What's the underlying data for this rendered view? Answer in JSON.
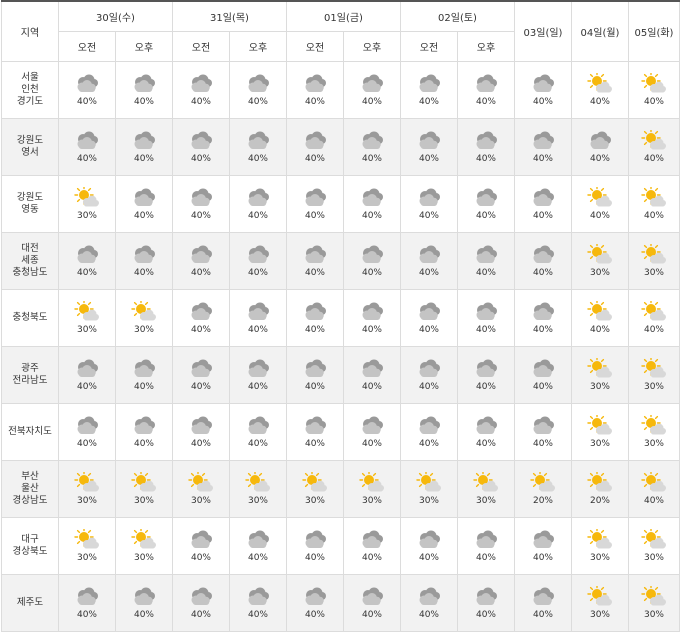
{
  "header": {
    "region_label": "지역",
    "days": [
      {
        "label": "30일(수)",
        "split": true
      },
      {
        "label": "31일(목)",
        "split": true
      },
      {
        "label": "01일(금)",
        "split": true
      },
      {
        "label": "02일(토)",
        "split": true
      },
      {
        "label": "03일(일)",
        "split": false
      },
      {
        "label": "04일(월)",
        "split": false
      },
      {
        "label": "05일(화)",
        "split": false
      }
    ],
    "am": "오전",
    "pm": "오후"
  },
  "rows": [
    {
      "region": "서울\n인천\n경기도",
      "cells": [
        {
          "icon": "cloudy-icon",
          "pct": "40%"
        },
        {
          "icon": "cloudy-icon",
          "pct": "40%"
        },
        {
          "icon": "cloudy-icon",
          "pct": "40%"
        },
        {
          "icon": "cloudy-icon",
          "pct": "40%"
        },
        {
          "icon": "cloudy-icon",
          "pct": "40%"
        },
        {
          "icon": "cloudy-icon",
          "pct": "40%"
        },
        {
          "icon": "cloudy-icon",
          "pct": "40%"
        },
        {
          "icon": "cloudy-icon",
          "pct": "40%"
        },
        {
          "icon": "cloudy-icon",
          "pct": "40%"
        },
        {
          "icon": "partly-cloudy-icon",
          "pct": "40%"
        },
        {
          "icon": "partly-cloudy-icon",
          "pct": "40%"
        }
      ]
    },
    {
      "region": "강원도\n영서",
      "cells": [
        {
          "icon": "cloudy-icon",
          "pct": "40%"
        },
        {
          "icon": "cloudy-icon",
          "pct": "40%"
        },
        {
          "icon": "cloudy-icon",
          "pct": "40%"
        },
        {
          "icon": "cloudy-icon",
          "pct": "40%"
        },
        {
          "icon": "cloudy-icon",
          "pct": "40%"
        },
        {
          "icon": "cloudy-icon",
          "pct": "40%"
        },
        {
          "icon": "cloudy-icon",
          "pct": "40%"
        },
        {
          "icon": "cloudy-icon",
          "pct": "40%"
        },
        {
          "icon": "cloudy-icon",
          "pct": "40%"
        },
        {
          "icon": "cloudy-icon",
          "pct": "40%"
        },
        {
          "icon": "partly-cloudy-icon",
          "pct": "40%"
        }
      ]
    },
    {
      "region": "강원도\n영동",
      "cells": [
        {
          "icon": "partly-cloudy-icon",
          "pct": "30%"
        },
        {
          "icon": "cloudy-icon",
          "pct": "40%"
        },
        {
          "icon": "cloudy-icon",
          "pct": "40%"
        },
        {
          "icon": "cloudy-icon",
          "pct": "40%"
        },
        {
          "icon": "cloudy-icon",
          "pct": "40%"
        },
        {
          "icon": "cloudy-icon",
          "pct": "40%"
        },
        {
          "icon": "cloudy-icon",
          "pct": "40%"
        },
        {
          "icon": "cloudy-icon",
          "pct": "40%"
        },
        {
          "icon": "cloudy-icon",
          "pct": "40%"
        },
        {
          "icon": "partly-cloudy-icon",
          "pct": "40%"
        },
        {
          "icon": "partly-cloudy-icon",
          "pct": "40%"
        }
      ]
    },
    {
      "region": "대전\n세종\n충청남도",
      "cells": [
        {
          "icon": "cloudy-icon",
          "pct": "40%"
        },
        {
          "icon": "cloudy-icon",
          "pct": "40%"
        },
        {
          "icon": "cloudy-icon",
          "pct": "40%"
        },
        {
          "icon": "cloudy-icon",
          "pct": "40%"
        },
        {
          "icon": "cloudy-icon",
          "pct": "40%"
        },
        {
          "icon": "cloudy-icon",
          "pct": "40%"
        },
        {
          "icon": "cloudy-icon",
          "pct": "40%"
        },
        {
          "icon": "cloudy-icon",
          "pct": "40%"
        },
        {
          "icon": "cloudy-icon",
          "pct": "40%"
        },
        {
          "icon": "partly-cloudy-icon",
          "pct": "30%"
        },
        {
          "icon": "partly-cloudy-icon",
          "pct": "30%"
        }
      ]
    },
    {
      "region": "충청북도",
      "cells": [
        {
          "icon": "partly-cloudy-icon",
          "pct": "30%"
        },
        {
          "icon": "partly-cloudy-icon",
          "pct": "30%"
        },
        {
          "icon": "cloudy-icon",
          "pct": "40%"
        },
        {
          "icon": "cloudy-icon",
          "pct": "40%"
        },
        {
          "icon": "cloudy-icon",
          "pct": "40%"
        },
        {
          "icon": "cloudy-icon",
          "pct": "40%"
        },
        {
          "icon": "cloudy-icon",
          "pct": "40%"
        },
        {
          "icon": "cloudy-icon",
          "pct": "40%"
        },
        {
          "icon": "cloudy-icon",
          "pct": "40%"
        },
        {
          "icon": "partly-cloudy-icon",
          "pct": "40%"
        },
        {
          "icon": "partly-cloudy-icon",
          "pct": "40%"
        }
      ]
    },
    {
      "region": "광주\n전라남도",
      "cells": [
        {
          "icon": "cloudy-icon",
          "pct": "40%"
        },
        {
          "icon": "cloudy-icon",
          "pct": "40%"
        },
        {
          "icon": "cloudy-icon",
          "pct": "40%"
        },
        {
          "icon": "cloudy-icon",
          "pct": "40%"
        },
        {
          "icon": "cloudy-icon",
          "pct": "40%"
        },
        {
          "icon": "cloudy-icon",
          "pct": "40%"
        },
        {
          "icon": "cloudy-icon",
          "pct": "40%"
        },
        {
          "icon": "cloudy-icon",
          "pct": "40%"
        },
        {
          "icon": "cloudy-icon",
          "pct": "40%"
        },
        {
          "icon": "partly-cloudy-icon",
          "pct": "30%"
        },
        {
          "icon": "partly-cloudy-icon",
          "pct": "30%"
        }
      ]
    },
    {
      "region": "전북자치도",
      "cells": [
        {
          "icon": "cloudy-icon",
          "pct": "40%"
        },
        {
          "icon": "cloudy-icon",
          "pct": "40%"
        },
        {
          "icon": "cloudy-icon",
          "pct": "40%"
        },
        {
          "icon": "cloudy-icon",
          "pct": "40%"
        },
        {
          "icon": "cloudy-icon",
          "pct": "40%"
        },
        {
          "icon": "cloudy-icon",
          "pct": "40%"
        },
        {
          "icon": "cloudy-icon",
          "pct": "40%"
        },
        {
          "icon": "cloudy-icon",
          "pct": "40%"
        },
        {
          "icon": "cloudy-icon",
          "pct": "40%"
        },
        {
          "icon": "partly-cloudy-icon",
          "pct": "30%"
        },
        {
          "icon": "partly-cloudy-icon",
          "pct": "30%"
        }
      ]
    },
    {
      "region": "부산\n울산\n경상남도",
      "cells": [
        {
          "icon": "partly-cloudy-icon",
          "pct": "30%"
        },
        {
          "icon": "partly-cloudy-icon",
          "pct": "30%"
        },
        {
          "icon": "partly-cloudy-icon",
          "pct": "30%"
        },
        {
          "icon": "partly-cloudy-icon",
          "pct": "30%"
        },
        {
          "icon": "partly-cloudy-icon",
          "pct": "30%"
        },
        {
          "icon": "partly-cloudy-icon",
          "pct": "30%"
        },
        {
          "icon": "partly-cloudy-icon",
          "pct": "30%"
        },
        {
          "icon": "partly-cloudy-icon",
          "pct": "30%"
        },
        {
          "icon": "partly-cloudy-icon",
          "pct": "20%"
        },
        {
          "icon": "partly-cloudy-icon",
          "pct": "20%"
        },
        {
          "icon": "partly-cloudy-icon",
          "pct": "40%"
        }
      ]
    },
    {
      "region": "대구\n경상북도",
      "cells": [
        {
          "icon": "partly-cloudy-icon",
          "pct": "30%"
        },
        {
          "icon": "partly-cloudy-icon",
          "pct": "30%"
        },
        {
          "icon": "cloudy-icon",
          "pct": "40%"
        },
        {
          "icon": "cloudy-icon",
          "pct": "40%"
        },
        {
          "icon": "cloudy-icon",
          "pct": "40%"
        },
        {
          "icon": "cloudy-icon",
          "pct": "40%"
        },
        {
          "icon": "cloudy-icon",
          "pct": "40%"
        },
        {
          "icon": "cloudy-icon",
          "pct": "40%"
        },
        {
          "icon": "cloudy-icon",
          "pct": "40%"
        },
        {
          "icon": "partly-cloudy-icon",
          "pct": "30%"
        },
        {
          "icon": "partly-cloudy-icon",
          "pct": "30%"
        }
      ]
    },
    {
      "region": "제주도",
      "cells": [
        {
          "icon": "cloudy-icon",
          "pct": "40%"
        },
        {
          "icon": "cloudy-icon",
          "pct": "40%"
        },
        {
          "icon": "cloudy-icon",
          "pct": "40%"
        },
        {
          "icon": "cloudy-icon",
          "pct": "40%"
        },
        {
          "icon": "cloudy-icon",
          "pct": "40%"
        },
        {
          "icon": "cloudy-icon",
          "pct": "40%"
        },
        {
          "icon": "cloudy-icon",
          "pct": "40%"
        },
        {
          "icon": "cloudy-icon",
          "pct": "40%"
        },
        {
          "icon": "cloudy-icon",
          "pct": "40%"
        },
        {
          "icon": "partly-cloudy-icon",
          "pct": "30%"
        },
        {
          "icon": "partly-cloudy-icon",
          "pct": "30%"
        }
      ]
    }
  ],
  "colors": {
    "sun": "#f6b80c",
    "cloud_back": "#9a9a9a",
    "cloud_front": "#c4c4c4",
    "cloud_light": "#d8d8d8",
    "border": "#dcdcdc",
    "alt_row": "#f2f2f2"
  }
}
